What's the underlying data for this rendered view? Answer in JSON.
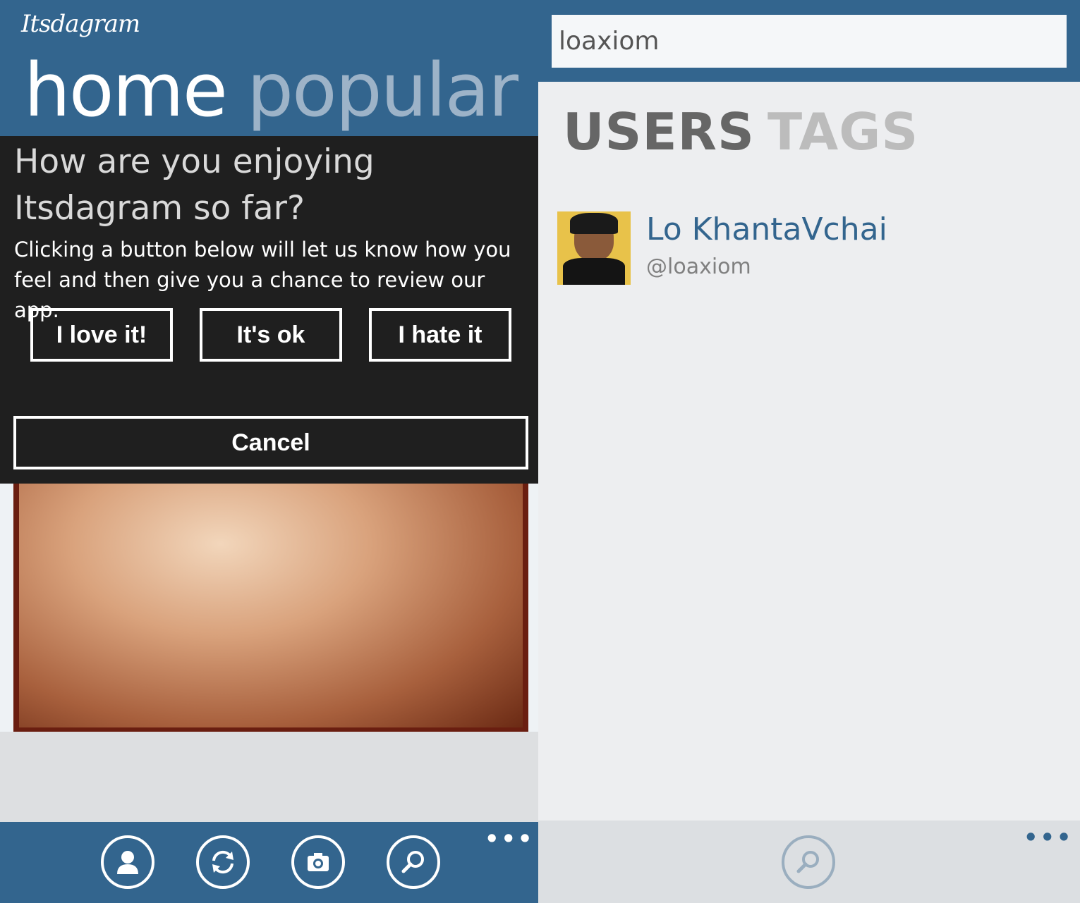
{
  "left_screen": {
    "app_name": "Itsdagram",
    "pivot": {
      "active": "home",
      "inactive": "popular"
    },
    "dialog": {
      "title": "How are you enjoying Itsdagram so far?",
      "message": "Clicking a button below will let us know how you feel and then give you a chance to review our app.",
      "buttons": {
        "love": "I love it!",
        "ok": "It's ok",
        "hate": "I hate it",
        "cancel": "Cancel"
      }
    },
    "app_bar": {
      "icons": [
        "profile-icon",
        "refresh-icon",
        "camera-icon",
        "search-icon"
      ],
      "more": "•••"
    }
  },
  "right_screen": {
    "search": {
      "value": "loaxiom"
    },
    "tabs": {
      "active": "USERS",
      "inactive": "TAGS"
    },
    "results": [
      {
        "name": "Lo KhantaVchai",
        "handle": "@loaxiom"
      }
    ],
    "app_bar": {
      "icons": [
        "search-icon"
      ],
      "more": "•••"
    }
  },
  "colors": {
    "accent": "#33658e",
    "dialog_bg": "#1f1f1f",
    "inactive_pivot": "#9db3c8"
  }
}
